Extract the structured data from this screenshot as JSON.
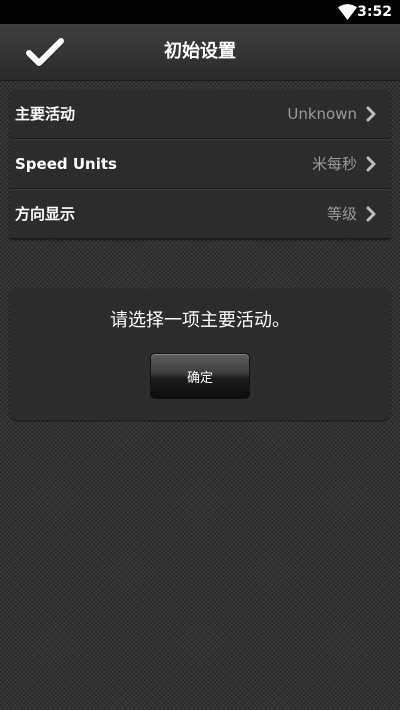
{
  "status_bar": {
    "time": "3:52",
    "icons": [
      "wifi-icon"
    ]
  },
  "header": {
    "title": "初始设置",
    "confirm_icon": "checkmark-icon"
  },
  "settings": {
    "rows": [
      {
        "label": "主要活动",
        "value": "Unknown"
      },
      {
        "label": "Speed Units",
        "value": "米每秒"
      },
      {
        "label": "方向显示",
        "value": "等级"
      }
    ]
  },
  "alert": {
    "message": "请选择一项主要活动。",
    "ok_label": "确定"
  },
  "colors": {
    "background": "#3a3a3a",
    "panel": "#2c2c2c",
    "value_text": "#9a9a9a",
    "status_bar": "#000000"
  }
}
